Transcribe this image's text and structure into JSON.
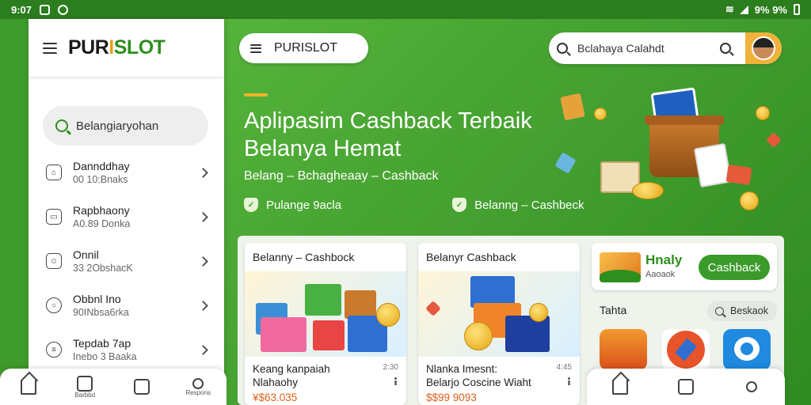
{
  "status_bar": {
    "time": "9:07",
    "battery": "9% 9%"
  },
  "sidebar": {
    "logo": {
      "part1": "PUR",
      "part2": "I",
      "part3": "SLOT"
    },
    "search_placeholder": "Belangiaryohan",
    "items": [
      {
        "label": "Dannddhay",
        "sub": "00 10:Bnaks"
      },
      {
        "label": "Rapbhaony",
        "sub": "A0.89 Donka"
      },
      {
        "label": "Onnil",
        "sub": "33 2ObshacK"
      },
      {
        "label": "Obbnl Ino",
        "sub": "90INbsa6rka"
      },
      {
        "label": "Tepdab 7ap",
        "sub": "Inebo 3 Baaka"
      }
    ]
  },
  "header": {
    "brand_pill": "PURISLOT",
    "search_placeholder": "Bclahaya Calahdt"
  },
  "hero": {
    "title_line1": "Aplipasim Cashback Terbaik",
    "title_line2": "Belanya Hemat",
    "subtitle": "Belang – Bchagheaay – Cashback",
    "chip1": "Pulange 9acla",
    "chip2": "Belanng – Cashbeck",
    "chip1_icon": "shield-icon",
    "chip2_icon": "shield-icon"
  },
  "products": [
    {
      "header": "Belanny – Cashbock",
      "name1": "Keang kanpaiah",
      "name2": "Nlahaohy",
      "price": "¥$63.035",
      "meta": "2:30"
    },
    {
      "header": "Belanyr Cashback",
      "name1": "Nlanka Imesnt:",
      "name2": "Belarjo Coscine Wiaht",
      "price": "$$99 9093",
      "meta": "4:45"
    }
  ],
  "promo": {
    "title": "Hnaly",
    "subtitle": "Aaoaok",
    "button": "Cashback"
  },
  "tray": {
    "label": "Tahta",
    "search": "Beskaok"
  },
  "bottom_nav_left": [
    {
      "icon": "home-icon",
      "label": ""
    },
    {
      "icon": "list-icon",
      "label": "Barbbd"
    },
    {
      "icon": "document-icon",
      "label": ""
    },
    {
      "icon": "user-icon",
      "label": "Respons"
    }
  ],
  "bottom_nav_right": [
    {
      "icon": "home-icon"
    },
    {
      "icon": "document-icon"
    },
    {
      "icon": "user-icon"
    }
  ],
  "colors": {
    "brand_green": "#3f9a2c",
    "accent_orange": "#f2b52a",
    "price_orange": "#e0601a"
  }
}
